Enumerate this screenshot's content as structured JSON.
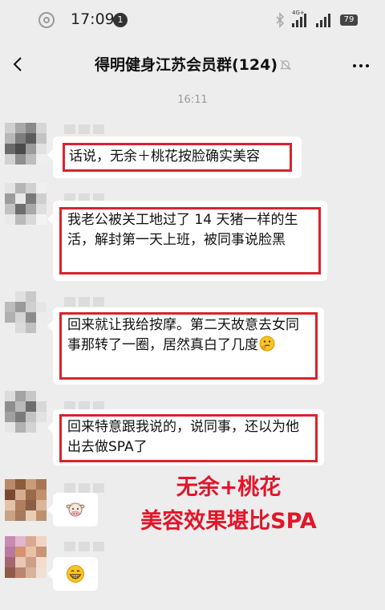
{
  "status_bar": {
    "time": "17:09",
    "notification_count": "1",
    "network": "4G+",
    "battery": "79"
  },
  "nav": {
    "title": "得明健身江苏会员群(124)"
  },
  "timestamp": "16:11",
  "messages": [
    {
      "text": "话说，无余＋桃花按脸确实美容"
    },
    {
      "text": "我老公被关工地过了 14 天猪一样的生活，解封第一天上班，被同事说脸黑"
    },
    {
      "text": "回来就让我给按摩。第二天故意去女同事那转了一圈，居然真白了几度"
    },
    {
      "text": "回来特意跟我说的，说同事，还以为他出去做SPA了"
    }
  ],
  "emoji_messages": [
    {
      "icon": "cow-face-icon"
    },
    {
      "icon": "grinning-face-icon"
    }
  ],
  "caption": {
    "line1": "无余+桃花",
    "line2": "美容效果堪比SPA"
  },
  "colors": {
    "highlight": "#d8232e",
    "caption": "#e0162a",
    "background": "#ededed"
  }
}
